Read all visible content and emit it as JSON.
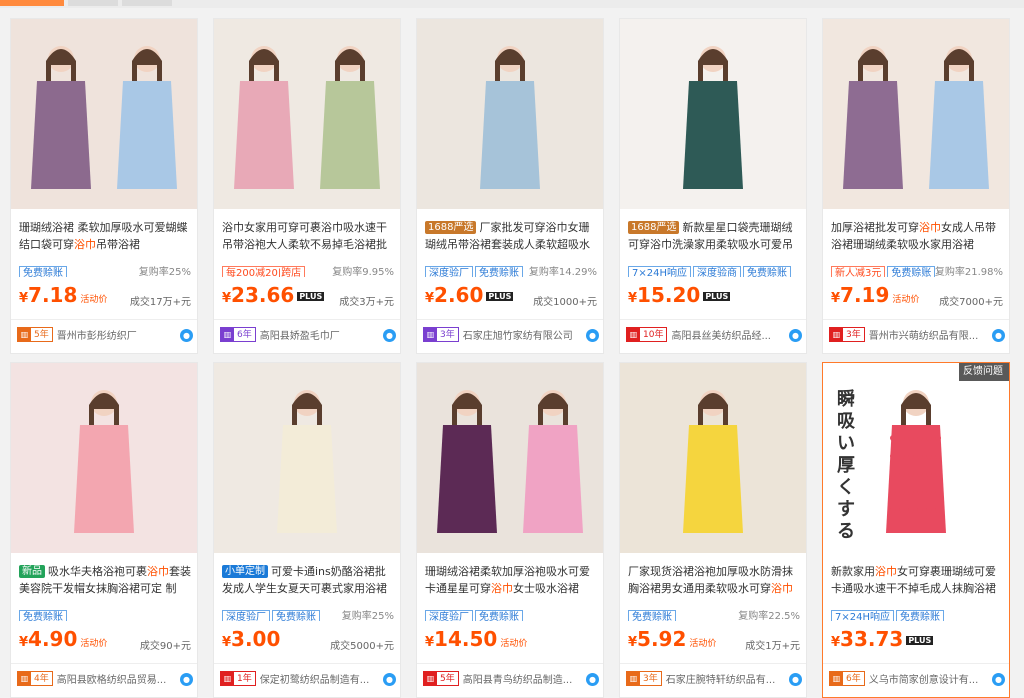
{
  "products": [
    {
      "title_pre": "珊瑚绒浴裙 柔软加厚吸水可爱蝴蝶结口袋可穿",
      "title_hl": "浴巾",
      "title_post": "吊带浴裙",
      "badge": "",
      "tags": [
        {
          "t": "免费赊账",
          "red": false
        }
      ],
      "repurchase": "复购率25%",
      "price": "7.18",
      "price_tag": "活动价",
      "plus": false,
      "sold": "成交17万+元",
      "years": "5年",
      "year_style": "orange",
      "store": "晋州市彭彤纺织厂",
      "img": "a"
    },
    {
      "title_pre": "浴巾女家用可穿可裹",
      "title_hl": "",
      "title_post": "浴巾吸水速干吊带浴袍大人柔软不易掉毛浴裙批发",
      "badge": "",
      "tags": [
        {
          "t": "每200减20|跨店",
          "red": true
        }
      ],
      "repurchase": "复购率9.95%",
      "price": "23.66",
      "price_tag": "",
      "plus": true,
      "sold": "成交3万+元",
      "years": "6年",
      "year_style": "purple",
      "store": "高阳县娇盈毛巾厂",
      "img": "b"
    },
    {
      "title_pre": "厂家批发可穿浴巾女珊瑚绒吊带浴裙套装成人柔软超吸水不掉",
      "title_hl": "",
      "title_post": "",
      "badge": "1688严选",
      "tags": [
        {
          "t": "深度验厂",
          "red": false
        },
        {
          "t": "免费赊账",
          "red": false
        }
      ],
      "repurchase": "复购率14.29%",
      "price": "2.60",
      "price_tag": "",
      "plus": true,
      "sold": "成交1000+元",
      "years": "3年",
      "year_style": "purple",
      "store": "石家庄旭竹家纺有限公司",
      "img": "c"
    },
    {
      "title_pre": "新款星星口袋壳珊瑚绒可穿浴巾洗澡家用柔软吸水可爱吊带浴",
      "title_hl": "",
      "title_post": "",
      "badge": "1688严选",
      "tags": [
        {
          "t": "7×24H响应",
          "red": false
        },
        {
          "t": "深度验商",
          "red": false
        },
        {
          "t": "免费赊账",
          "red": false
        }
      ],
      "repurchase": "",
      "price": "15.20",
      "price_tag": "",
      "plus": true,
      "sold": "",
      "years": "10年",
      "year_style": "red",
      "store": "高阳县丝美纺织品经...",
      "img": "d"
    },
    {
      "title_pre": "加厚浴裙批发可穿",
      "title_hl": "浴巾",
      "title_post": "女成人吊带浴裙珊瑚绒柔软吸水家用浴裙",
      "badge": "",
      "tags": [
        {
          "t": "新人减3元",
          "red": true
        },
        {
          "t": "免费赊账",
          "red": false
        }
      ],
      "repurchase": "复购率21.98%",
      "price": "7.19",
      "price_tag": "活动价",
      "plus": false,
      "sold": "成交7000+元",
      "years": "3年",
      "year_style": "red",
      "store": "晋州市兴萌纺织品有限...",
      "img": "e"
    },
    {
      "title_pre": "吸水华夫格浴袍可裹",
      "title_hl": "浴巾",
      "title_post": "套装 美容院干发帽女抹胸浴裙可定 制",
      "badge": "新品",
      "tags": [
        {
          "t": "免费赊账",
          "red": false
        }
      ],
      "repurchase": "",
      "price": "4.90",
      "price_tag": "活动价",
      "plus": false,
      "sold": "成交90+元",
      "years": "4年",
      "year_style": "orange",
      "store": "高阳县欧格纺织品贸易...",
      "img": "f"
    },
    {
      "title_pre": "可爱卡通ins奶酪浴裙批发成人学生女夏天可裹式家用浴裙柔软",
      "title_hl": "",
      "title_post": "",
      "badge": "小单定制",
      "tags": [
        {
          "t": "深度验厂",
          "red": false
        },
        {
          "t": "免费赊账",
          "red": false
        }
      ],
      "repurchase": "复购率25%",
      "price": "3.00",
      "price_tag": "",
      "plus": false,
      "sold": "成交5000+元",
      "years": "1年",
      "year_style": "red",
      "store": "保定初鹭纺织品制造有...",
      "img": "g"
    },
    {
      "title_pre": "珊瑚绒浴裙柔软加厚浴袍吸水可爱卡通星星可穿",
      "title_hl": "浴巾",
      "title_post": "女士吸水浴裙",
      "badge": "",
      "tags": [
        {
          "t": "深度验厂",
          "red": false
        },
        {
          "t": "免费赊账",
          "red": false
        }
      ],
      "repurchase": "",
      "price": "14.50",
      "price_tag": "活动价",
      "plus": false,
      "sold": "",
      "years": "5年",
      "year_style": "red",
      "store": "高阳县青鸟纺织品制造...",
      "img": "h"
    },
    {
      "title_pre": "厂家现货浴裙浴袍加厚吸水防滑抹胸浴裙男女通用柔软吸水可穿",
      "title_hl": "浴巾",
      "title_post": "",
      "badge": "",
      "tags": [
        {
          "t": "免费赊账",
          "red": false
        }
      ],
      "repurchase": "复购率22.5%",
      "price": "5.92",
      "price_tag": "活动价",
      "plus": false,
      "sold": "成交1万+元",
      "years": "3年",
      "year_style": "orange",
      "store": "石家庄腕特轩纺织品有...",
      "img": "i"
    },
    {
      "title_pre": "新款家用",
      "title_hl": "浴巾",
      "title_post": "女可穿裹珊瑚绒可爱卡通吸水速干不掉毛成人抹胸浴裙",
      "badge": "",
      "tags": [
        {
          "t": "7×24H响应",
          "red": false
        },
        {
          "t": "免费赊账",
          "red": false
        }
      ],
      "repurchase": "",
      "price": "33.73",
      "price_tag": "",
      "plus": true,
      "sold": "",
      "years": "6年",
      "year_style": "orange",
      "store": "义乌市简家创意设计有...",
      "img": "j",
      "feedback": "反馈问题",
      "img_text": "瞬吸い 厚くする"
    }
  ]
}
